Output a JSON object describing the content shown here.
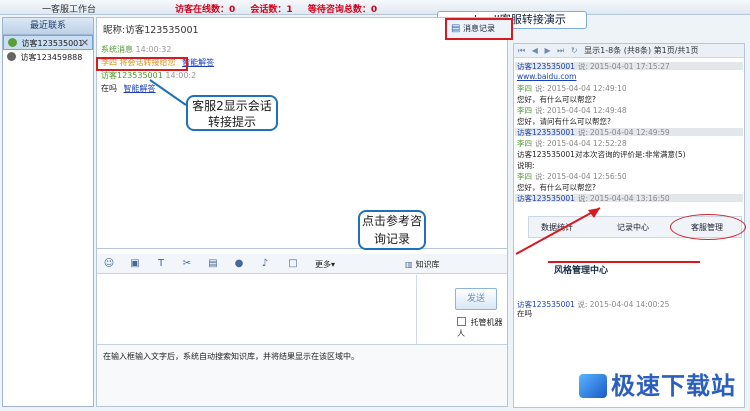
{
  "window": {
    "app_title": "一客服工作台",
    "stats": [
      "访客在线数：0",
      "会话数：1",
      "等待咨询总数：0"
    ]
  },
  "banner": "webcall客服转接演示",
  "sidebar": {
    "header": "最近联系",
    "visitors": [
      {
        "label": "访客123535001",
        "active": true,
        "close": "✕"
      },
      {
        "label": "访客123459888",
        "active": false
      }
    ]
  },
  "chat": {
    "nickname": "昵称:访客123535001",
    "messages": [
      {
        "label": "系统消息",
        "time": "14:00:32"
      },
      {
        "label": "李四",
        "content": "将会话转接给您",
        "link": "智能解答"
      },
      {
        "label": "访客123535001",
        "time": "14:00:2"
      },
      {
        "label": "在吗",
        "link": "智能解答"
      }
    ]
  },
  "toolbar": {
    "more": "更多▾",
    "knowledge": "知识库",
    "record_button": "消息记录"
  },
  "input": {
    "send": "发送",
    "robot": "托管机器人"
  },
  "hint": "在输入框输入文字后，系统自动搜索知识库，并将结果显示在该区域中。",
  "history": {
    "nav": "显示1-8条 (共8条)  第1页/共1页",
    "lines": [
      {
        "who": "访客123535001",
        "say": "说:",
        "time": "2015-04-01 17:15:27",
        "type": "vis",
        "shade": true
      },
      {
        "text": "www.baidu.com",
        "type": "url"
      },
      {
        "who": "李四",
        "say": "说:",
        "time": "2015-04-04 12:49:10",
        "type": "name"
      },
      {
        "text": "您好，有什么可以帮您?"
      },
      {
        "who": "李四",
        "say": "说:",
        "time": "2015-04-04 12:49:48",
        "type": "name"
      },
      {
        "text": "您好，请问有什么可以帮您?"
      },
      {
        "who": "访客123535001",
        "say": "说:",
        "time": "2015-04-04 12:49:59",
        "type": "vis",
        "shade": true
      },
      {
        "who": "李四",
        "say": "说:",
        "time": "2015-04-04 12:52:28",
        "type": "name"
      },
      {
        "text": "访客123535001对本次咨询的评价是:非常满意(5)"
      },
      {
        "text": "说明:"
      },
      {
        "who": "李四",
        "say": "说:",
        "time": "2015-04-04 12:56:50",
        "type": "name"
      },
      {
        "text": "您好，有什么可以帮您?"
      },
      {
        "who": "访客123535001",
        "say": "说:",
        "time": "2015-04-04 13:16:50",
        "type": "vis",
        "shade": true
      }
    ],
    "tabs": [
      "数据统计",
      "记录中心",
      "客服管理"
    ],
    "style_title": "风格管理中心",
    "bottom": {
      "who": "访客123535001",
      "say": "说:",
      "time": "2015-04-04 14:00:25",
      "text": "在吗"
    }
  },
  "callouts": {
    "transfer": "客服2显示会话转接提示",
    "query": "点击参考咨询记录"
  },
  "watermark": "极速下载站"
}
